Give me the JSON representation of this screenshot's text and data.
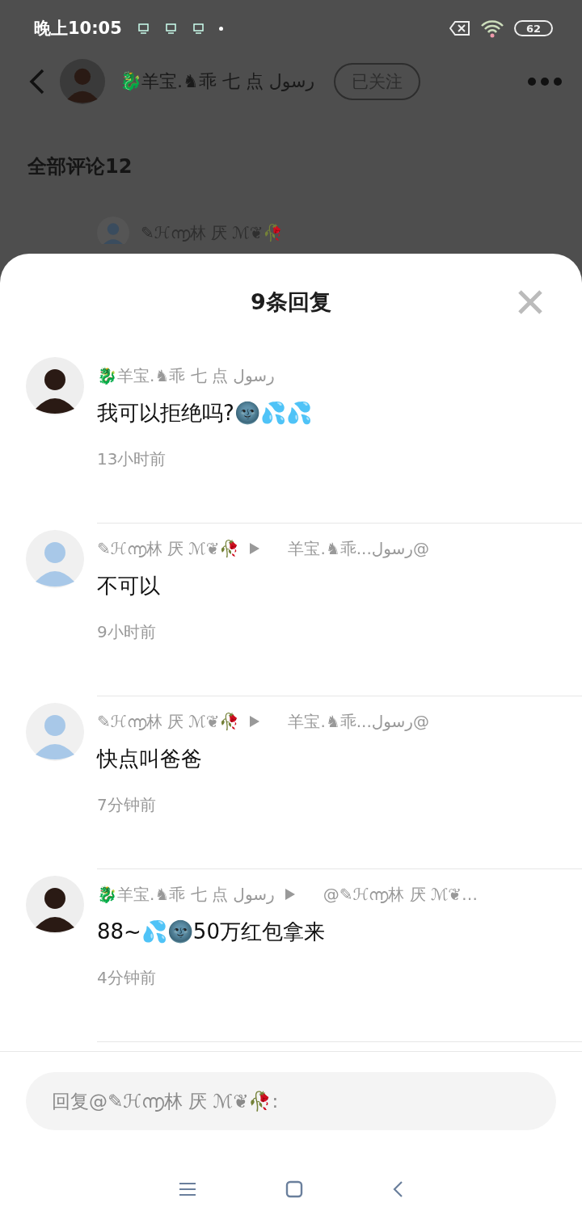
{
  "status_bar": {
    "time": "晚上10:05",
    "battery": "62"
  },
  "header": {
    "name": "🐉羊宝.♞乖 七 点 رسول",
    "follow_button": "已关注"
  },
  "section_title": "全部评论12",
  "background_comment": {
    "author": "✎ℋ൬林 厌 ℳ❦🥀"
  },
  "sheet": {
    "title": "9条回复"
  },
  "replies": [
    {
      "author": "🐉羊宝.♞乖 七 点 رسول",
      "text": "我可以拒绝吗?🌚💦💦",
      "time": "13小时前"
    },
    {
      "author": "✎ℋ൬林 厌 ℳ❦🥀",
      "target": "羊宝.♞乖...رسول@",
      "text": "不可以",
      "time": "9小时前"
    },
    {
      "author": "✎ℋ൬林 厌 ℳ❦🥀",
      "target": "羊宝.♞乖...رسول@",
      "text": "快点叫爸爸",
      "time": "7分钟前"
    },
    {
      "author": "🐉羊宝.♞乖 七 点 رسول",
      "target": "@✎ℋ൬林 厌 ℳ❦…",
      "text": "88~💦🌚50万红包拿来",
      "time": "4分钟前"
    }
  ],
  "reply_field": {
    "placeholder": "回复@✎ℋ൬林 厌 ℳ❦🥀:"
  }
}
